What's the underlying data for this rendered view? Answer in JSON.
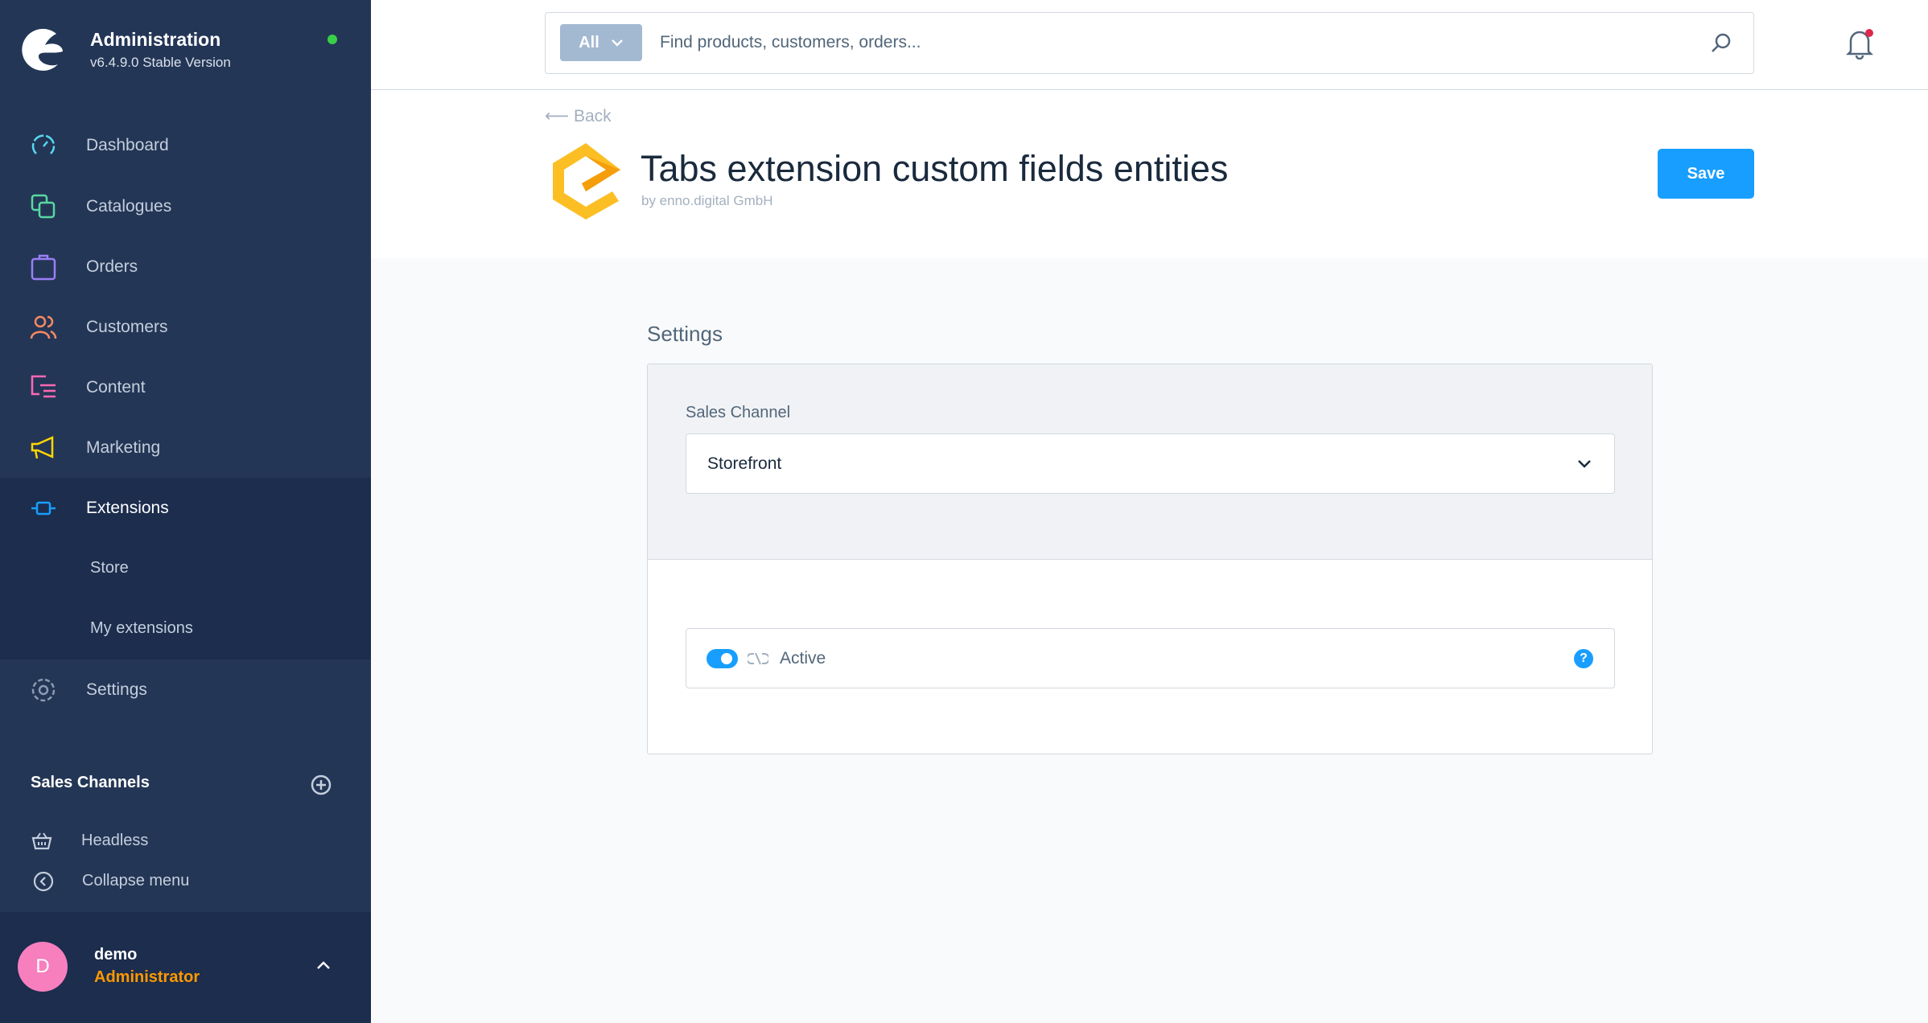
{
  "sidebar": {
    "brand_title": "Administration",
    "brand_version": "v6.4.9.0 Stable Version",
    "status_color": "#37d046",
    "items": [
      {
        "label": "Dashboard",
        "icon": "gauge-icon",
        "color": "#57d9f0"
      },
      {
        "label": "Catalogues",
        "icon": "copy-icon",
        "color": "#57d9a3"
      },
      {
        "label": "Orders",
        "icon": "bag-icon",
        "color": "#9a7ff5"
      },
      {
        "label": "Customers",
        "icon": "users-icon",
        "color": "#f88962"
      },
      {
        "label": "Content",
        "icon": "content-icon",
        "color": "#ff68b4"
      },
      {
        "label": "Marketing",
        "icon": "megaphone-icon",
        "color": "#ffd700"
      },
      {
        "label": "Extensions",
        "icon": "plug-icon",
        "color": "#189eff"
      }
    ],
    "sub_items": [
      {
        "label": "Store"
      },
      {
        "label": "My extensions"
      }
    ],
    "settings_label": "Settings",
    "sales_channels_title": "Sales Channels",
    "sales_channels": [
      {
        "label": "Headless"
      }
    ],
    "collapse_label": "Collapse menu",
    "user": {
      "initial": "D",
      "name": "demo",
      "role": "Administrator"
    }
  },
  "topbar": {
    "search_type": "All",
    "search_placeholder": "Find products, customers, orders..."
  },
  "header": {
    "back_label": "Back",
    "title": "Tabs extension custom fields entities",
    "subtitle": "by enno.digital GmbH",
    "save_label": "Save"
  },
  "settings": {
    "title": "Settings",
    "sales_channel_label": "Sales Channel",
    "sales_channel_value": "Storefront",
    "active_label": "Active",
    "active_value": true,
    "help": "?"
  },
  "colors": {
    "accent": "#189eff",
    "sidebar": "#243656"
  }
}
